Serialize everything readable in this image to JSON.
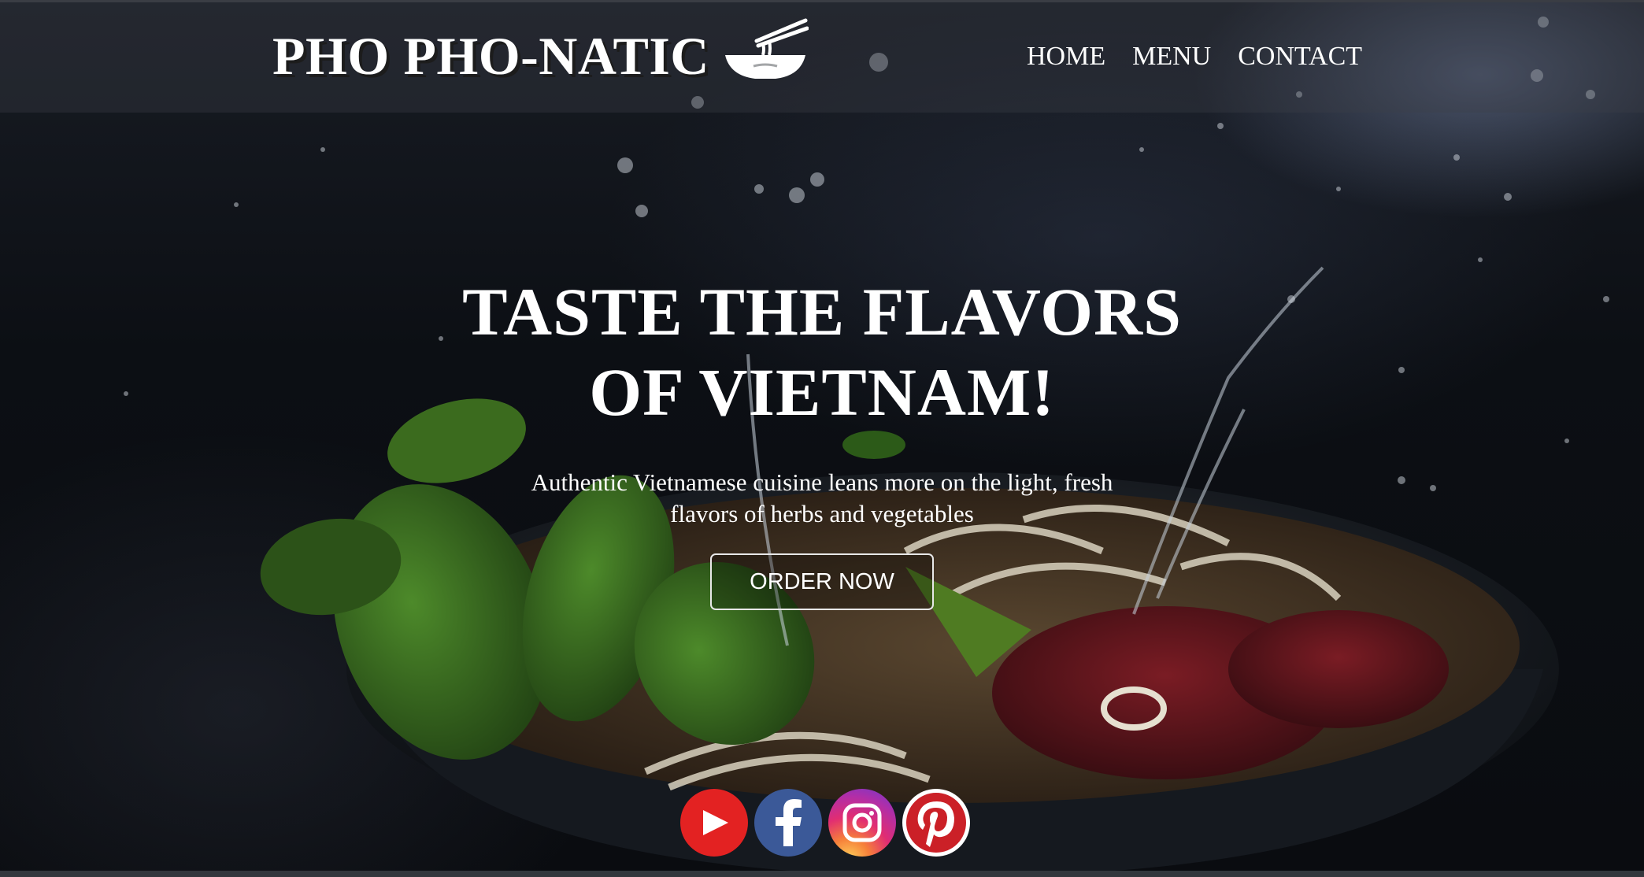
{
  "header": {
    "brand": "PHO PHO-NATIC",
    "logo_icon": "noodle-bowl-icon",
    "nav": [
      {
        "label": "HOME"
      },
      {
        "label": "MENU"
      },
      {
        "label": "CONTACT"
      }
    ]
  },
  "hero": {
    "title_line1": "TASTE THE FLAVORS",
    "title_line2": "OF VIETNAM!",
    "subtitle_line1": "Authentic Vietnamese cuisine leans more on the light, fresh",
    "subtitle_line2": "flavors of herbs and vegetables",
    "cta_label": "ORDER NOW"
  },
  "social": [
    {
      "icon": "youtube-icon",
      "color": "#e32222"
    },
    {
      "icon": "facebook-icon",
      "color": "#3b5998"
    },
    {
      "icon": "instagram-icon",
      "color": "#e12d72"
    },
    {
      "icon": "pinterest-icon",
      "color": "#cb2027"
    }
  ],
  "colors": {
    "text": "#ffffff",
    "header_overlay": "rgba(60,64,72,0.35)",
    "background": "#0b0d11"
  }
}
